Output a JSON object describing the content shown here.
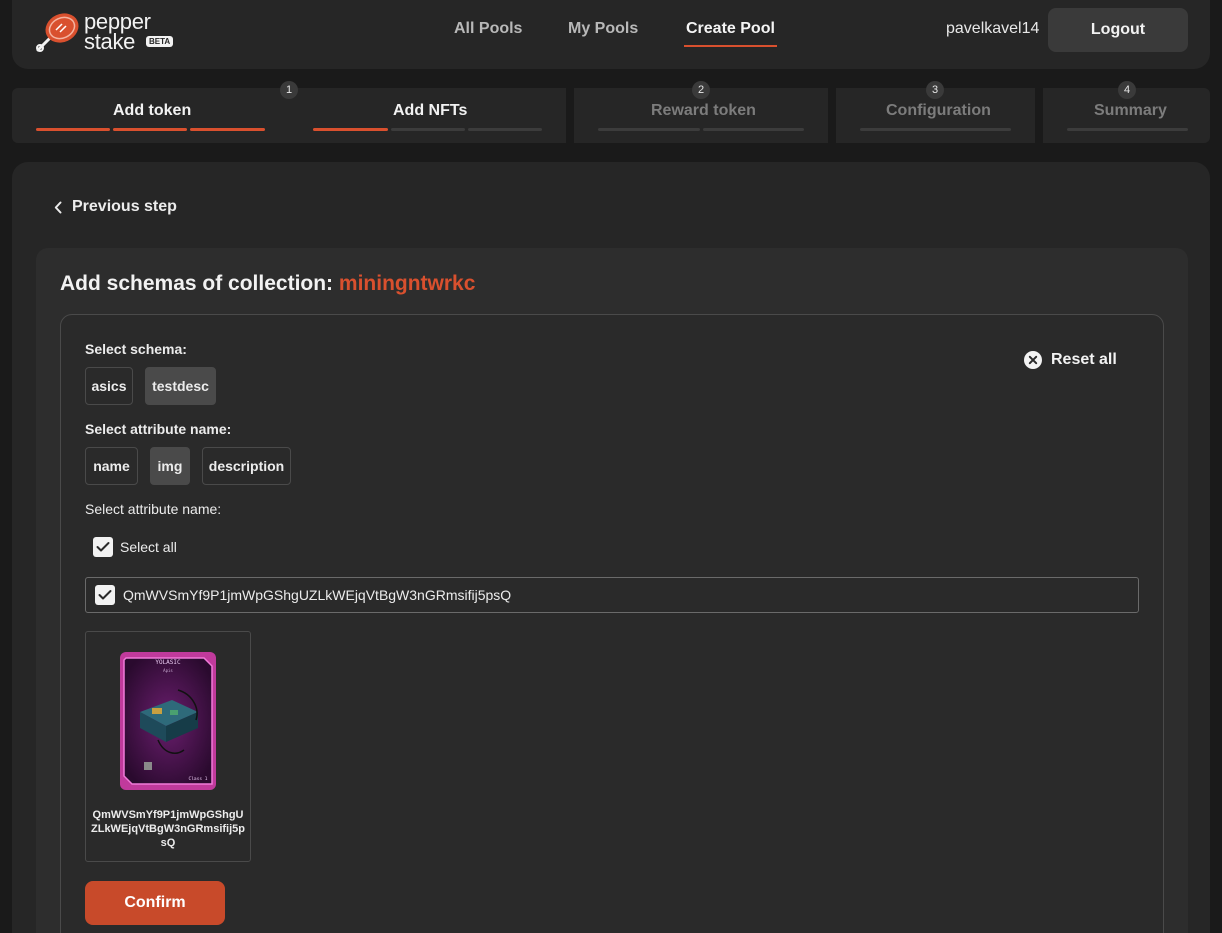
{
  "brand": {
    "line1": "pepper",
    "line2": "stake",
    "badge": "BETA"
  },
  "nav": {
    "all_pools": "All Pools",
    "my_pools": "My Pools",
    "create_pool": "Create Pool"
  },
  "user": {
    "name": "pavelkavel14",
    "logout": "Logout"
  },
  "steps": {
    "add_token": "Add token",
    "add_nfts": "Add NFTs",
    "reward_token": "Reward token",
    "configuration": "Configuration",
    "summary": "Summary",
    "num1": "1",
    "num2": "2",
    "num3": "3",
    "num4": "4"
  },
  "main": {
    "previous_step": "Previous step",
    "title_prefix": "Add schemas of collection:",
    "collection": "miningntwrkc",
    "select_schema_label": "Select schema:",
    "schemas": [
      "asics",
      "testdesc"
    ],
    "selected_schema": "testdesc",
    "select_attr_label": "Select attribute name:",
    "attributes": [
      "name",
      "img",
      "description"
    ],
    "selected_attribute": "img",
    "select_attr_label2": "Select attribute name:",
    "select_all": "Select all",
    "value_item": "QmWVSmYf9P1jmWpGShgUZLkWEjqVtBgW3nGRmsifij5psQ",
    "nft_caption": "QmWVSmYf9P1jmWpGShgUZLkWEjqVtBgW3nGRmsifij5psQ",
    "nft_card_header": "YOLASIC",
    "nft_card_sub": "Apis",
    "nft_card_footer": "Class 1",
    "reset_all": "Reset all",
    "confirm": "Confirm"
  },
  "colors": {
    "accent": "#d9502e",
    "background": "#1a1a1a",
    "panel": "#262626",
    "card": "#2d2d2d"
  }
}
